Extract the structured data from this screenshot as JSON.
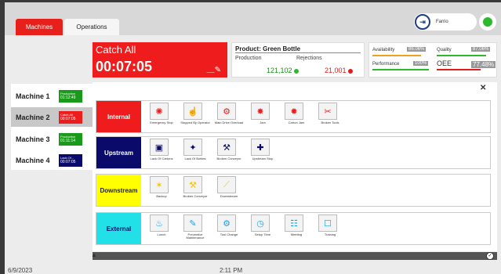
{
  "tabs": [
    {
      "label": "Machines",
      "active": true
    },
    {
      "label": "Operations",
      "active": false
    }
  ],
  "user": {
    "name": "Farrio",
    "status_color": "#2eb82e"
  },
  "catch": {
    "title": "Catch All",
    "timer": "00:07:05"
  },
  "product": {
    "title": "Product: Green Bottle",
    "production_label": "Production",
    "production_value": "121,102",
    "rejections_label": "Rejections",
    "rejections_value": "21,001"
  },
  "kpis": [
    {
      "label": "Availability",
      "value": "86.06%",
      "bar_color": "#f0a020",
      "fill": 0.8606
    },
    {
      "label": "Quality",
      "value": "87.06%",
      "bar_color": "#2eb82e",
      "fill": 0.8706
    },
    {
      "label": "Performance",
      "value": "100%",
      "bar_color": "#2eb82e",
      "fill": 1.0
    },
    {
      "label": "OEE",
      "value": "77.48%",
      "bar_color": "#e01c1c",
      "fill": 0.7748
    }
  ],
  "machines": [
    {
      "name": "Machine 1",
      "state": "Production",
      "time": "01:12:49",
      "color": "#1a9a1a",
      "selected": false
    },
    {
      "name": "Machine 2",
      "state": "Catch All",
      "time": "00:07:05",
      "color": "#ee1c1c",
      "selected": true
    },
    {
      "name": "Machine 3",
      "state": "Production",
      "time": "01:11:14",
      "color": "#1a9a1a",
      "selected": false
    },
    {
      "name": "Machine 4",
      "state": "Lack Of...",
      "time": "00:07:05",
      "color": "#0a0a6a",
      "selected": false
    }
  ],
  "categories": [
    {
      "label": "Internal",
      "bg": "#ee1c1c",
      "fg": "#ffffff",
      "reasons": [
        {
          "label": "Emergency Stop",
          "icon": "alert-light-icon",
          "glyph": "✺",
          "color": "#ee1c1c"
        },
        {
          "label": "Stopped By Operator",
          "icon": "operator-icon",
          "glyph": "☝",
          "color": "#ee1c1c"
        },
        {
          "label": "Main Drive Overload",
          "icon": "gear-overload-icon",
          "glyph": "⚙",
          "color": "#ee1c1c"
        },
        {
          "label": "Jam",
          "icon": "jam-icon",
          "glyph": "✸",
          "color": "#ee1c1c"
        },
        {
          "label": "Carton Jam",
          "icon": "carton-jam-icon",
          "glyph": "✹",
          "color": "#ee1c1c"
        },
        {
          "label": "Broken Tools",
          "icon": "broken-tools-icon",
          "glyph": "✂",
          "color": "#ee1c1c"
        }
      ]
    },
    {
      "label": "Upstream",
      "bg": "#0a0a6a",
      "fg": "#ffffff",
      "reasons": [
        {
          "label": "Lack Of Cartons",
          "icon": "carton-icon",
          "glyph": "▣",
          "color": "#0a0a6a"
        },
        {
          "label": "Lack Of Bottles",
          "icon": "bottle-icon",
          "glyph": "✦",
          "color": "#0a0a6a"
        },
        {
          "label": "Broken Conveyor",
          "icon": "conveyor-icon",
          "glyph": "⚒",
          "color": "#0a0a6a"
        },
        {
          "label": "Upstream Stop",
          "icon": "upstream-stop-icon",
          "glyph": "✚",
          "color": "#0a0a6a"
        }
      ]
    },
    {
      "label": "Downstream",
      "bg": "#ffff00",
      "fg": "#222222",
      "reasons": [
        {
          "label": "Backup",
          "icon": "backup-icon",
          "glyph": "✶",
          "color": "#f5c400"
        },
        {
          "label": "Broken Conveyor",
          "icon": "conveyor-icon",
          "glyph": "⚒",
          "color": "#f5c400"
        },
        {
          "label": "Downstream",
          "icon": "downstream-icon",
          "glyph": "⟋",
          "color": "#f5c400"
        }
      ]
    },
    {
      "label": "External",
      "bg": "#22e0e8",
      "fg": "#0a0a6a",
      "reasons": [
        {
          "label": "Lunch",
          "icon": "lunch-icon",
          "glyph": "♨",
          "color": "#1aa0e8"
        },
        {
          "label": "Preventive Maintenance",
          "icon": "maintenance-icon",
          "glyph": "✎",
          "color": "#1aa0e8"
        },
        {
          "label": "Tool Change",
          "icon": "tool-change-icon",
          "glyph": "⚙",
          "color": "#1aa0e8"
        },
        {
          "label": "Setup Time",
          "icon": "clock-icon",
          "glyph": "◷",
          "color": "#1aa0e8"
        },
        {
          "label": "Meeting",
          "icon": "meeting-icon",
          "glyph": "☷",
          "color": "#1aa0e8"
        },
        {
          "label": "Training",
          "icon": "training-icon",
          "glyph": "☐",
          "color": "#1aa0e8"
        }
      ]
    }
  ],
  "footer": {
    "date": "6/9/2023",
    "time": "2:11 PM"
  }
}
